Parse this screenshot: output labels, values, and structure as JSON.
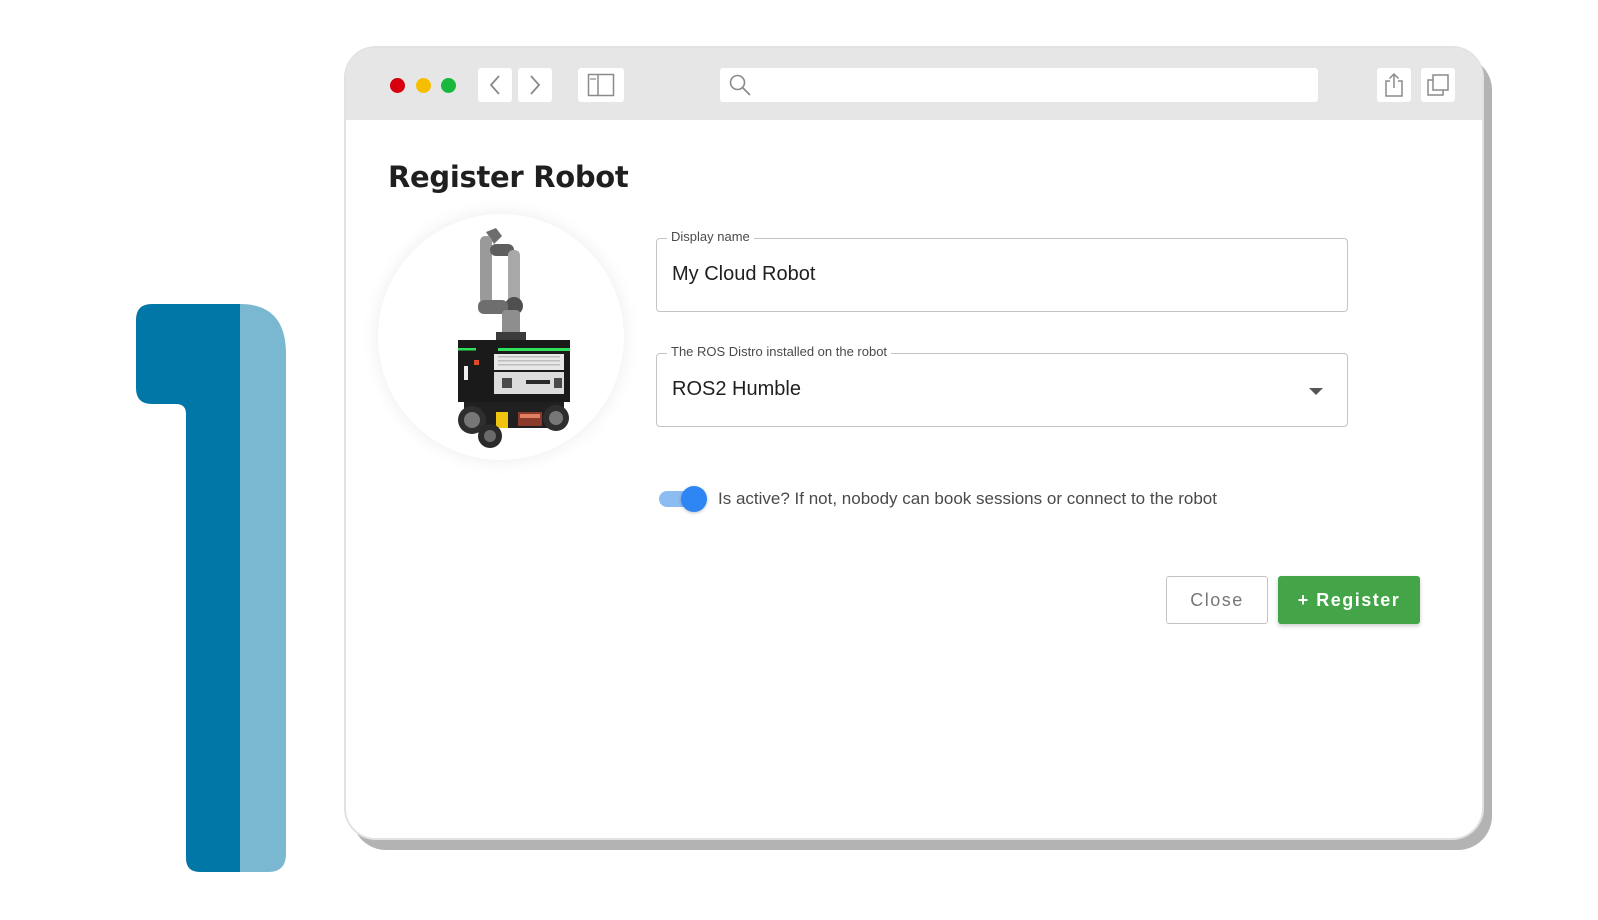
{
  "step_number": "1",
  "colors": {
    "numeral_dark": "#0077a6",
    "numeral_light": "#7ab8d1",
    "register_green": "#43a547",
    "toggle_blue": "#2e86f5"
  },
  "browser": {
    "buttons": {
      "back": "chevron-left-icon",
      "forward": "chevron-right-icon",
      "sidebar": "sidebar-icon",
      "share": "share-icon",
      "tabs": "tabs-icon"
    },
    "address_value": ""
  },
  "dialog": {
    "title": "Register Robot",
    "robot_image": "robot-arm-on-mobile-base",
    "display_name": {
      "label": "Display name",
      "value": "My Cloud Robot"
    },
    "ros_distro": {
      "label": "The ROS Distro installed on the robot",
      "value": "ROS2 Humble"
    },
    "active_toggle": {
      "checked": true,
      "label": "Is active? If not, nobody can book sessions or connect to the robot"
    },
    "close_label": "Close",
    "register_label": "+ Register"
  }
}
